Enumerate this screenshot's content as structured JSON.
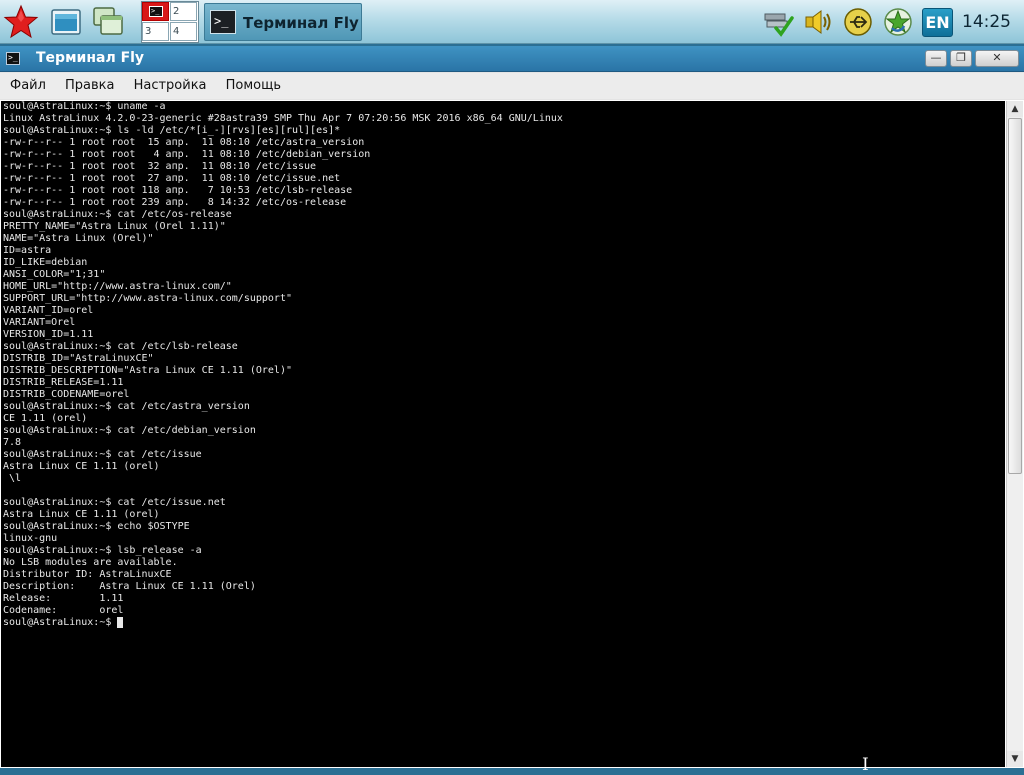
{
  "taskbar": {
    "pager": [
      "1",
      "2",
      "3",
      "4"
    ],
    "mini_term_glyph": ">_",
    "task_glyph": ">_",
    "task_label": "Терминал Fly",
    "lang": "EN",
    "clock": "14:25",
    "icons": {
      "start": "red-star-icon",
      "desktop": "show-desktop-icon",
      "windows": "windows-icon",
      "network": "network-tray-icon",
      "volume": "volume-icon",
      "usb": "usb-icon",
      "updates": "update-star-icon"
    },
    "colors": {
      "active_pager": "#d81818",
      "panel": "#b6dbe8"
    }
  },
  "window": {
    "title": "Терминал Fly",
    "title_glyph": ">_",
    "controls": {
      "minimize": "—",
      "maximize": "❐",
      "close": "✕"
    },
    "menu": [
      "Файл",
      "Правка",
      "Настройка",
      "Помощь"
    ]
  },
  "terminal": {
    "lines": [
      "soul@AstraLinux:~$ uname -a",
      "Linux AstraLinux 4.2.0-23-generic #28astra39 SMP Thu Apr 7 07:20:56 MSK 2016 x86_64 GNU/Linux",
      "soul@AstraLinux:~$ ls -ld /etc/*[i_-][rvs][es][rul][es]*",
      "-rw-r--r-- 1 root root  15 апр.  11 08:10 /etc/astra_version",
      "-rw-r--r-- 1 root root   4 апр.  11 08:10 /etc/debian_version",
      "-rw-r--r-- 1 root root  32 апр.  11 08:10 /etc/issue",
      "-rw-r--r-- 1 root root  27 апр.  11 08:10 /etc/issue.net",
      "-rw-r--r-- 1 root root 118 апр.   7 10:53 /etc/lsb-release",
      "-rw-r--r-- 1 root root 239 апр.   8 14:32 /etc/os-release",
      "soul@AstraLinux:~$ cat /etc/os-release",
      "PRETTY_NAME=\"Astra Linux (Orel 1.11)\"",
      "NAME=\"Astra Linux (Orel)\"",
      "ID=astra",
      "ID_LIKE=debian",
      "ANSI_COLOR=\"1;31\"",
      "HOME_URL=\"http://www.astra-linux.com/\"",
      "SUPPORT_URL=\"http://www.astra-linux.com/support\"",
      "VARIANT_ID=orel",
      "VARIANT=Orel",
      "VERSION_ID=1.11",
      "soul@AstraLinux:~$ cat /etc/lsb-release",
      "DISTRIB_ID=\"AstraLinuxCE\"",
      "DISTRIB_DESCRIPTION=\"Astra Linux CE 1.11 (Orel)\"",
      "DISTRIB_RELEASE=1.11",
      "DISTRIB_CODENAME=orel",
      "soul@AstraLinux:~$ cat /etc/astra_version",
      "CE 1.11 (orel)",
      "soul@AstraLinux:~$ cat /etc/debian_version",
      "7.8",
      "soul@AstraLinux:~$ cat /etc/issue",
      "Astra Linux CE 1.11 (orel)",
      " \\l",
      "",
      "soul@AstraLinux:~$ cat /etc/issue.net",
      "Astra Linux CE 1.11 (orel)",
      "soul@AstraLinux:~$ echo $OSTYPE",
      "linux-gnu",
      "soul@AstraLinux:~$ lsb_release -a",
      "No LSB modules are available.",
      "Distributor ID: AstraLinuxCE",
      "Description:    Astra Linux CE 1.11 (Orel)",
      "Release:        1.11",
      "Codename:       orel"
    ],
    "prompt": "soul@AstraLinux:~$ ",
    "colors": {
      "background": "#000000",
      "foreground": "#e8e8e8"
    }
  },
  "scrollbar": {
    "up": "▲",
    "down": "▼",
    "position_fraction": 0.0
  }
}
